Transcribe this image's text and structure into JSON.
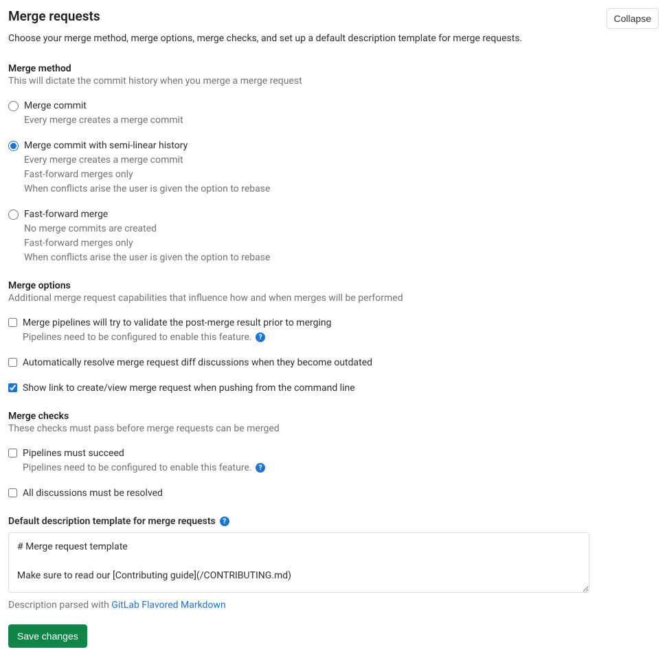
{
  "header": {
    "title": "Merge requests",
    "collapse": "Collapse",
    "subtitle": "Choose your merge method, merge options, merge checks, and set up a default description template for merge requests."
  },
  "mergeMethod": {
    "title": "Merge method",
    "desc": "This will dictate the commit history when you merge a merge request",
    "options": [
      {
        "label": "Merge commit",
        "subs": [
          "Every merge creates a merge commit"
        ],
        "checked": false
      },
      {
        "label": "Merge commit with semi-linear history",
        "subs": [
          "Every merge creates a merge commit",
          "Fast-forward merges only",
          "When conflicts arise the user is given the option to rebase"
        ],
        "checked": true
      },
      {
        "label": "Fast-forward merge",
        "subs": [
          "No merge commits are created",
          "Fast-forward merges only",
          "When conflicts arise the user is given the option to rebase"
        ],
        "checked": false
      }
    ]
  },
  "mergeOptions": {
    "title": "Merge options",
    "desc": "Additional merge request capabilities that influence how and when merges will be performed",
    "options": [
      {
        "label": "Merge pipelines will try to validate the post-merge result prior to merging",
        "sub": "Pipelines need to be configured to enable this feature.",
        "help": true,
        "checked": false
      },
      {
        "label": "Automatically resolve merge request diff discussions when they become outdated",
        "checked": false
      },
      {
        "label": "Show link to create/view merge request when pushing from the command line",
        "checked": true
      }
    ]
  },
  "mergeChecks": {
    "title": "Merge checks",
    "desc": "These checks must pass before merge requests can be merged",
    "options": [
      {
        "label": "Pipelines must succeed",
        "sub": "Pipelines need to be configured to enable this feature.",
        "help": true,
        "checked": false
      },
      {
        "label": "All discussions must be resolved",
        "checked": false
      }
    ]
  },
  "template": {
    "label": "Default description template for merge requests",
    "value": "# Merge request template\n\nMake sure to read our [Contributing guide](/CONTRIBUTING.md)",
    "note_prefix": "Description parsed with ",
    "note_link": "GitLab Flavored Markdown"
  },
  "save": "Save changes"
}
